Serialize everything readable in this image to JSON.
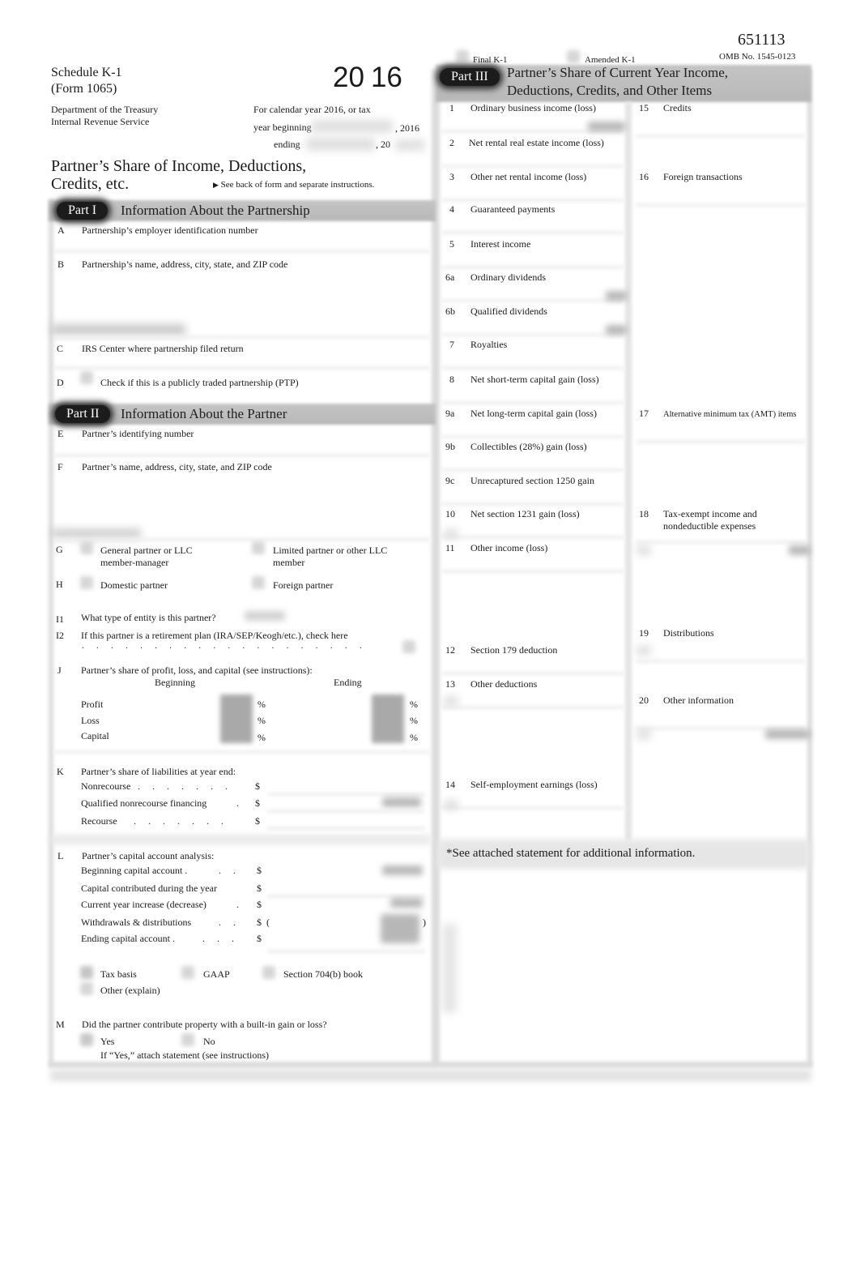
{
  "header": {
    "form_number_code": "651113",
    "omb": "OMB No. 1545-0123",
    "schedule": "Schedule K-1",
    "form": "(Form 1065)",
    "dept1": "Department of the Treasury",
    "dept2": "Internal Revenue Service",
    "year_left": "20",
    "year_right": "16",
    "calendar_line": "For calendar year 2016, or tax",
    "year_beginning_label": "year beginning",
    "year_beginning_suffix": ", 2016",
    "ending_label": "ending",
    "ending_suffix": ", 20",
    "title_line1": "Partner’s Share of Income, Deductions,",
    "title_line2": "Credits, etc.",
    "see_back": "See back of form and separate instructions.",
    "final_k1": "Final K-1",
    "amended_k1": "Amended K-1"
  },
  "part1": {
    "badge": "Part I",
    "title": "Information About the Partnership",
    "items": [
      {
        "letter": "A",
        "label": "Partnership’s employer identification number"
      },
      {
        "letter": "B",
        "label": "Partnership’s name, address, city, state, and ZIP code"
      },
      {
        "letter": "C",
        "label": "IRS Center where partnership filed return"
      },
      {
        "letter": "D",
        "label": "Check if this is a publicly traded partnership (PTP)"
      }
    ]
  },
  "part2": {
    "badge": "Part II",
    "title": "Information About the Partner",
    "E": {
      "letter": "E",
      "label": "Partner’s identifying number"
    },
    "F": {
      "letter": "F",
      "label": "Partner’s name, address, city, state, and ZIP code"
    },
    "G": {
      "letter": "G",
      "opt1_l1": "General partner or LLC",
      "opt1_l2": "member-manager",
      "opt2_l1": "Limited partner or other LLC",
      "opt2_l2": "member"
    },
    "H": {
      "letter": "H",
      "opt1": "Domestic partner",
      "opt2": "Foreign partner"
    },
    "I1": {
      "letter": "I1",
      "label": "What type of entity is this partner?"
    },
    "I2": {
      "letter": "I2",
      "label": "If this partner is a retirement plan (IRA/SEP/Keogh/etc.), check here",
      "dots": ". . . . . . . . . . . . . . . . . . . ."
    },
    "J": {
      "letter": "J",
      "label": "Partner’s share of profit, loss, and capital (see instructions):",
      "beginning": "Beginning",
      "ending": "Ending",
      "rows": [
        "Profit",
        "Loss",
        "Capital"
      ],
      "pct": "%"
    },
    "K": {
      "letter": "K",
      "label": "Partner’s share of liabilities at year end:",
      "rows": [
        {
          "label": "Nonrecourse",
          "dots": ". . . . . . .",
          "cur": "$"
        },
        {
          "label": "Qualified nonrecourse financing",
          "dots": ".",
          "cur": "$"
        },
        {
          "label": "Recourse",
          "dots": ". . . . . . .",
          "cur": "$"
        }
      ]
    },
    "L": {
      "letter": "L",
      "label": "Partner’s capital account analysis:",
      "rows": [
        {
          "label": "Beginning  capital  account .",
          "dots": ". .",
          "cur": "$"
        },
        {
          "label": "Capital contributed during the year",
          "dots": "",
          "cur": "$"
        },
        {
          "label": "Current year increase (decrease)",
          "dots": ".",
          "cur": "$"
        },
        {
          "label": "Withdrawals & distributions",
          "dots": ". .",
          "cur": "$  (",
          "close": ")"
        },
        {
          "label": "Ending capital account .",
          "dots": ". . .",
          "cur": "$"
        }
      ],
      "basis_options": [
        "Tax basis",
        "GAAP",
        "Section 704(b) book",
        "Other (explain)"
      ]
    },
    "M": {
      "letter": "M",
      "label": "Did the partner contribute property with a built-in gain or loss?",
      "yes": "Yes",
      "no": "No",
      "note": "If “Yes,” attach statement (see instructions)"
    }
  },
  "part3": {
    "badge": "Part III",
    "title_line1": "Partner’s Share of Current Year Income,",
    "title_line2": "Deductions, Credits, and Other Items",
    "left_items": [
      {
        "num": "1",
        "label": "Ordinary business income (loss)"
      },
      {
        "num": "2",
        "label": "Net rental real estate income (loss)"
      },
      {
        "num": "3",
        "label": "Other net rental income (loss)"
      },
      {
        "num": "4",
        "label": "Guaranteed payments"
      },
      {
        "num": "5",
        "label": "Interest income"
      },
      {
        "num": "6a",
        "label": "Ordinary dividends"
      },
      {
        "num": "6b",
        "label": "Qualified dividends"
      },
      {
        "num": "7",
        "label": "Royalties"
      },
      {
        "num": "8",
        "label": "Net short-term capital gain (loss)"
      },
      {
        "num": "9a",
        "label": "Net long-term capital gain (loss)"
      },
      {
        "num": "9b",
        "label": "Collectibles (28%) gain (loss)"
      },
      {
        "num": "9c",
        "label": "Unrecaptured section 1250 gain"
      },
      {
        "num": "10",
        "label": "Net section 1231 gain (loss)"
      },
      {
        "num": "11",
        "label": "Other income (loss)"
      },
      {
        "num": "12",
        "label": "Section 179 deduction"
      },
      {
        "num": "13",
        "label": "Other deductions"
      },
      {
        "num": "14",
        "label": "Self-employment earnings (loss)"
      }
    ],
    "right_items": [
      {
        "num": "15",
        "label": "Credits"
      },
      {
        "num": "16",
        "label": "Foreign transactions"
      },
      {
        "num": "17",
        "label": "Alternative minimum tax (AMT) items"
      },
      {
        "num": "18",
        "label": "Tax-exempt income and",
        "label2": "nondeductible expenses"
      },
      {
        "num": "19",
        "label": "Distributions"
      },
      {
        "num": "20",
        "label": "Other information"
      }
    ],
    "statement_note": "*See attached statement for additional information."
  }
}
